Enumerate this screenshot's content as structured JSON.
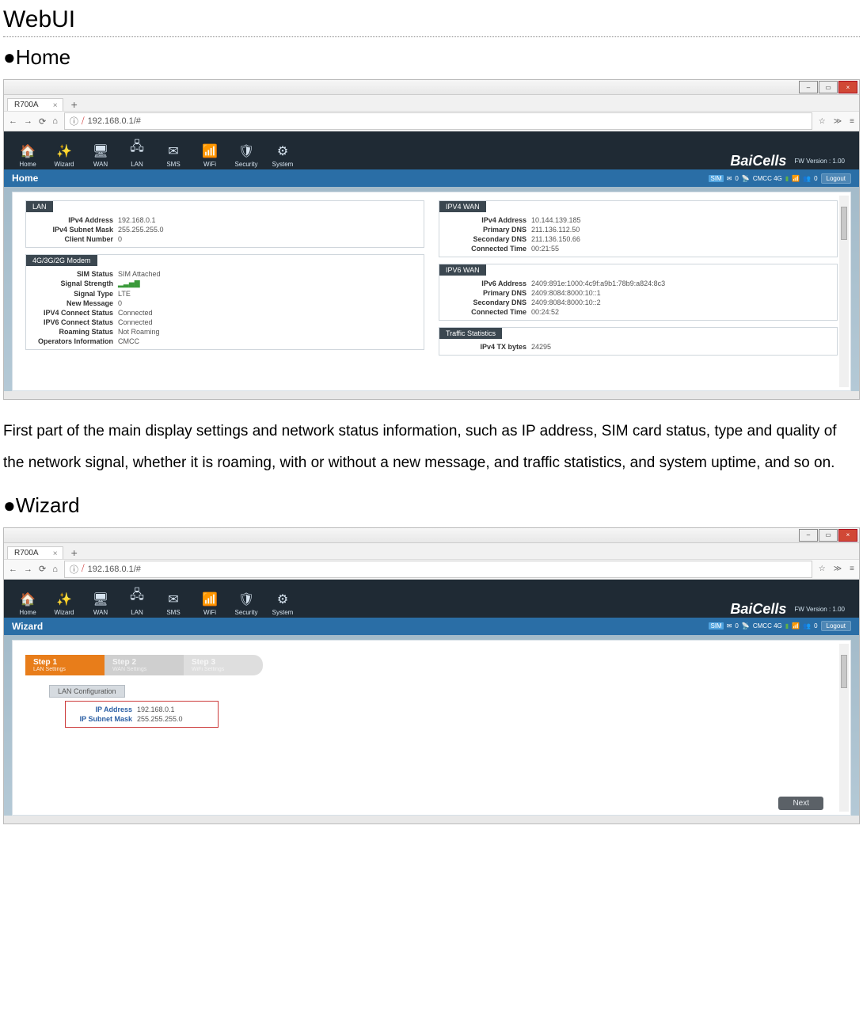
{
  "doc": {
    "title": "WebUI",
    "section_home": "●Home",
    "para_home": "First part of the main display settings and network status information, such as IP address, SIM card status, type and quality of the network signal, whether it is roaming, with or without a new message, and traffic statistics, and system uptime, and so on.",
    "section_wizard": "●Wizard"
  },
  "browser": {
    "tab_title": "R700A",
    "url": "192.168.0.1/#",
    "win_min": "–",
    "win_max": "▭",
    "win_close": "×",
    "back": "←",
    "fwd": "→",
    "reload": "⟳",
    "home": "⌂",
    "info": "ⓘ",
    "star": "☆",
    "menu": "≫",
    "bars": "≡"
  },
  "app": {
    "nav": {
      "home": "Home",
      "wizard": "Wizard",
      "wan": "WAN",
      "lan": "LAN",
      "sms": "SMS",
      "wifi": "WiFi",
      "security": "Security",
      "system": "System"
    },
    "brand": "BaiCells",
    "fw": "FW Version : 1.00",
    "status": {
      "carrier": "CMCC  4G",
      "logout": "Logout",
      "zero": "0"
    }
  },
  "home_page": {
    "title": "Home",
    "panels": {
      "lan": {
        "title": "LAN",
        "ipv4_addr_lbl": "IPv4 Address",
        "ipv4_addr": "192.168.0.1",
        "mask_lbl": "IPv4 Subnet Mask",
        "mask": "255.255.255.0",
        "clients_lbl": "Client Number",
        "clients": "0"
      },
      "modem": {
        "title": "4G/3G/2G Modem",
        "sim_lbl": "SIM Status",
        "sim": "SIM Attached",
        "sig_lbl": "Signal Strength",
        "sig": "▂▃▅▇",
        "type_lbl": "Signal Type",
        "type": "LTE",
        "msg_lbl": "New Message",
        "msg": "0",
        "v4c_lbl": "IPV4 Connect Status",
        "v4c": "Connected",
        "v6c_lbl": "IPV6 Connect Status",
        "v6c": "Connected",
        "roam_lbl": "Roaming Status",
        "roam": "Not Roaming",
        "op_lbl": "Operators Information",
        "op": "CMCC"
      },
      "wan4": {
        "title": "IPV4 WAN",
        "addr_lbl": "IPv4 Address",
        "addr": "10.144.139.185",
        "pdns_lbl": "Primary DNS",
        "pdns": "211.136.112.50",
        "sdns_lbl": "Secondary DNS",
        "sdns": "211.136.150.66",
        "ct_lbl": "Connected Time",
        "ct": "00:21:55"
      },
      "wan6": {
        "title": "IPV6 WAN",
        "addr_lbl": "IPv6 Address",
        "addr": "2409:891e:1000:4c9f:a9b1:78b9:a824:8c3",
        "pdns_lbl": "Primary DNS",
        "pdns": "2409:8084:8000:10::1",
        "sdns_lbl": "Secondary DNS",
        "sdns": "2409:8084:8000:10::2",
        "ct_lbl": "Connected Time",
        "ct": "00:24:52"
      },
      "traffic": {
        "title": "Traffic Statistics",
        "tx_lbl": "IPv4 TX bytes",
        "tx": "24295"
      }
    }
  },
  "wizard_page": {
    "title": "Wizard",
    "step1": "Step 1",
    "step1_sub": "LAN Settings",
    "step2": "Step 2",
    "step2_sub": "WAN Settings",
    "step3": "Step 3",
    "step3_sub": "WiFi Settings",
    "lanconf": "LAN Configuration",
    "ip_lbl": "IP Address",
    "ip": "192.168.0.1",
    "mask_lbl": "IP Subnet Mask",
    "mask": "255.255.255.0",
    "next": "Next"
  }
}
